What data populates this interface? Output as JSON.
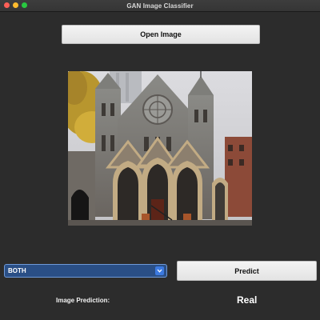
{
  "window": {
    "title": "GAN Image Classifier"
  },
  "toolbar": {
    "open_image_label": "Open Image"
  },
  "image": {
    "subject": "church-facade-photo"
  },
  "controls": {
    "model_select_value": "BOTH",
    "predict_label": "Predict"
  },
  "result": {
    "label": "Image Prediction:",
    "value": "Real"
  },
  "colors": {
    "window_bg": "#2c2c2c",
    "select_bg": "#2a4f86",
    "select_accent": "#3c7ae0",
    "button_bg": "#e9e9e9"
  }
}
